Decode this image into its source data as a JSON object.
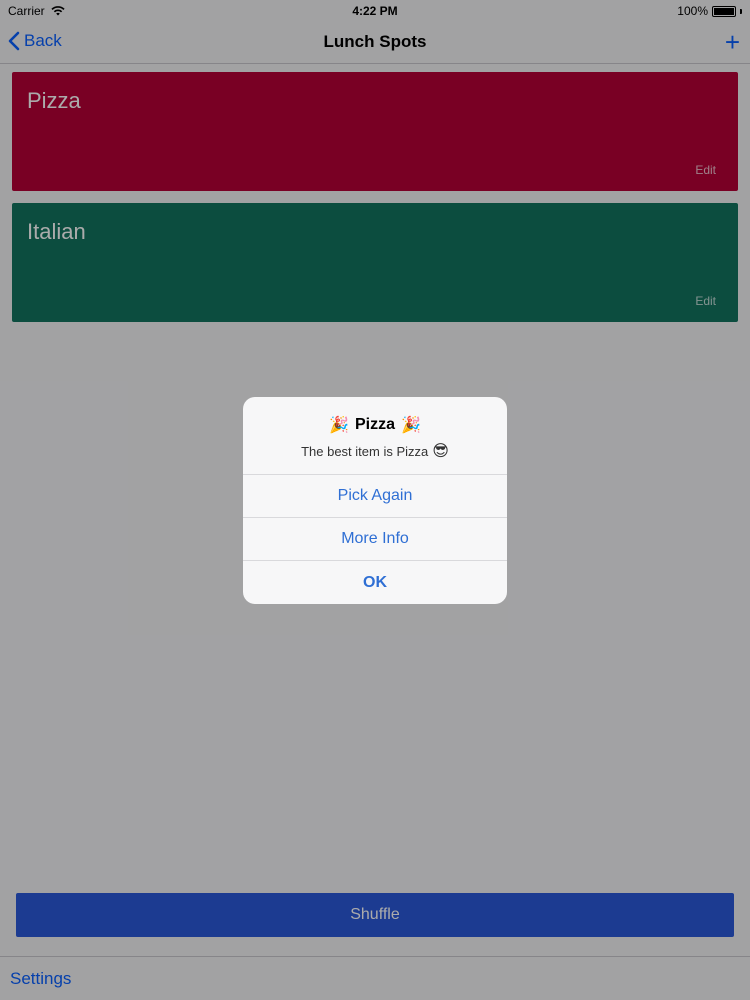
{
  "status_bar": {
    "carrier": "Carrier",
    "time": "4:22 PM",
    "battery": "100%"
  },
  "nav": {
    "back_label": "Back",
    "title": "Lunch Spots",
    "add_label": "+"
  },
  "cards": [
    {
      "title": "Pizza",
      "edit_label": "Edit",
      "color": "#b50036"
    },
    {
      "title": "Italian",
      "edit_label": "Edit",
      "color": "#12735f"
    }
  ],
  "shuffle": {
    "label": "Shuffle",
    "color": "#2a58d8"
  },
  "tab_bar": {
    "settings_label": "Settings"
  },
  "alert": {
    "title_emoji_left": "🎉",
    "title": "Pizza",
    "title_emoji_right": "🎉",
    "message": "The best item is Pizza",
    "message_emoji": "😎",
    "buttons": [
      {
        "label": "Pick Again"
      },
      {
        "label": "More Info"
      },
      {
        "label": "OK"
      }
    ]
  },
  "icons": {
    "back": "chevron-left-icon",
    "add": "plus-icon",
    "wifi": "wifi-icon",
    "battery": "battery-icon"
  }
}
